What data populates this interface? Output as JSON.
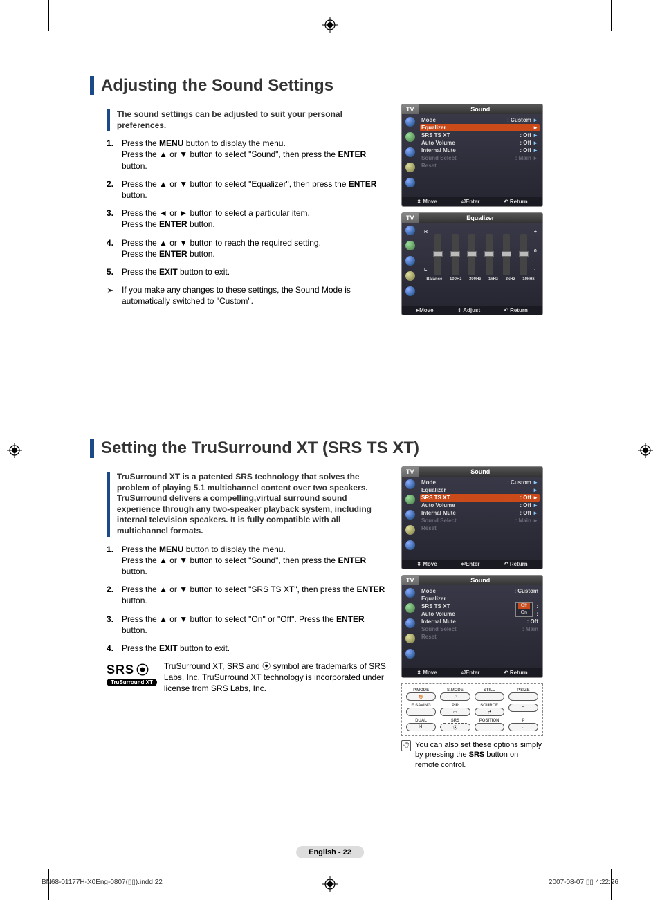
{
  "section1": {
    "title": "Adjusting the Sound Settings",
    "intro": "The sound settings can be adjusted to suit your personal preferences.",
    "steps": [
      {
        "num": "1.",
        "html": "Press the <b>MENU</b> button to display the menu.<br>Press the ▲ or ▼ button to select \"Sound\", then press the <b>ENTER</b> button."
      },
      {
        "num": "2.",
        "html": "Press the ▲ or ▼ button to select \"Equalizer\", then press the <b>ENTER</b> button."
      },
      {
        "num": "3.",
        "html": "Press the ◄ or ► button to select a particular item.<br>Press the <b>ENTER</b> button."
      },
      {
        "num": "4.",
        "html": "Press the ▲ or ▼ button to reach the required setting.<br>Press the <b>ENTER</b> button."
      },
      {
        "num": "5.",
        "html": "Press the <b>EXIT</b> button to exit."
      }
    ],
    "note": "If you make any changes to these settings, the Sound Mode is automatically switched to \"Custom\".",
    "osd1": {
      "tv": "TV",
      "title": "Sound",
      "rows": [
        {
          "lbl": "Mode",
          "val": ": Custom",
          "tri": "►"
        },
        {
          "lbl": "Equalizer",
          "val": "",
          "tri": "►",
          "hi": true
        },
        {
          "lbl": "SRS TS XT",
          "val": ": Off",
          "tri": "►"
        },
        {
          "lbl": "Auto Volume",
          "val": ": Off",
          "tri": "►"
        },
        {
          "lbl": "Internal Mute",
          "val": ": Off",
          "tri": "►"
        },
        {
          "lbl": "Sound Select",
          "val": ": Main",
          "tri": "►",
          "dim": true
        },
        {
          "lbl": "Reset",
          "val": "",
          "tri": "",
          "dim": true
        }
      ],
      "foot": [
        "⇕ Move",
        "⏎Enter",
        "↶ Return"
      ]
    },
    "osd2": {
      "tv": "TV",
      "title": "Equalizer",
      "left": [
        "R",
        "",
        "",
        "L"
      ],
      "right": [
        "+",
        "",
        "0",
        "",
        "-"
      ],
      "bands": [
        "Balance",
        "100Hz",
        "300Hz",
        "1kHz",
        "3kHz",
        "10kHz"
      ],
      "foot": [
        "▸Move",
        "⇕ Adjust",
        "↶ Return"
      ]
    }
  },
  "section2": {
    "title": "Setting the TruSurround XT (SRS TS XT)",
    "intro": "TruSurround XT is a patented SRS technology that solves the problem of playing 5.1 multichannel content over two speakers. TruSurround delivers a compelling,virtual surround sound experience through any two-speaker playback system, including internal television speakers. It is fully compatible with all multichannel formats.",
    "steps": [
      {
        "num": "1.",
        "html": "Press the <b>MENU</b> button to display the menu.<br>Press the ▲ or ▼ button to select \"Sound\", then press the <b>ENTER</b> button."
      },
      {
        "num": "2.",
        "html": "Press the ▲ or ▼ button to select \"SRS TS XT\", then press the <b>ENTER</b> button."
      },
      {
        "num": "3.",
        "html": "Press the ▲ or ▼ button to select \"On\" or \"Off\". Press the <b>ENTER</b> button."
      },
      {
        "num": "4.",
        "html": "Press the <b>EXIT</b> button to exit."
      }
    ],
    "srs_logo_top": "SRS",
    "srs_logo_pill": "TruSurround XT",
    "srs_text": "TruSurround XT, SRS and ⦿ symbol are trademarks of SRS Labs, Inc. TruSurround XT technology is incorporated under license from SRS Labs, Inc.",
    "osd1": {
      "tv": "TV",
      "title": "Sound",
      "rows": [
        {
          "lbl": "Mode",
          "val": ": Custom",
          "tri": "►"
        },
        {
          "lbl": "Equalizer",
          "val": "",
          "tri": "►"
        },
        {
          "lbl": "SRS TS XT",
          "val": ": Off",
          "tri": "►",
          "hi": true
        },
        {
          "lbl": "Auto Volume",
          "val": ": Off",
          "tri": "►"
        },
        {
          "lbl": "Internal Mute",
          "val": ": Off",
          "tri": "►"
        },
        {
          "lbl": "Sound Select",
          "val": ": Main",
          "tri": "►",
          "dim": true
        },
        {
          "lbl": "Reset",
          "val": "",
          "tri": "",
          "dim": true
        }
      ],
      "foot": [
        "⇕ Move",
        "⏎Enter",
        "↶ Return"
      ]
    },
    "osd2": {
      "tv": "TV",
      "title": "Sound",
      "rows": [
        {
          "lbl": "Mode",
          "val": ": Custom",
          "tri": ""
        },
        {
          "lbl": "Equalizer",
          "val": "",
          "tri": ""
        },
        {
          "lbl": "SRS TS XT",
          "val": ":",
          "tri": "",
          "hi_val_only": true,
          "popup": [
            "Off",
            "On"
          ]
        },
        {
          "lbl": "Auto Volume",
          "val": ":",
          "tri": ""
        },
        {
          "lbl": "Internal Mute",
          "val": ": Off",
          "tri": ""
        },
        {
          "lbl": "Sound Select",
          "val": ": Main",
          "tri": "",
          "dim": true
        },
        {
          "lbl": "Reset",
          "val": "",
          "tri": "",
          "dim": true
        }
      ],
      "foot": [
        "⇕ Move",
        "⏎Enter",
        "↶ Return"
      ]
    },
    "remote": {
      "rows": [
        [
          {
            "lbl": "P.MODE",
            "btn": "🎨"
          },
          {
            "lbl": "S.MODE",
            "btn": "♫"
          },
          {
            "lbl": "STILL",
            "btn": ""
          },
          {
            "lbl": "P.SIZE",
            "btn": ""
          }
        ],
        [
          {
            "lbl": "E.SAVING",
            "btn": ""
          },
          {
            "lbl": "PIP",
            "btn": "▭"
          },
          {
            "lbl": "SOURCE",
            "btn": "⇄"
          },
          {
            "lbl": "",
            "btn": "⌃"
          }
        ],
        [
          {
            "lbl": "DUAL",
            "btn": "I-II"
          },
          {
            "lbl": "SRS",
            "btn": "⦿",
            "hi": true
          },
          {
            "lbl": "POSITION",
            "btn": ""
          },
          {
            "lbl": "P",
            "btn": "⌄"
          }
        ]
      ]
    },
    "tip": "You can also set these options simply by pressing the <b>SRS</b> button on remote control."
  },
  "footer": {
    "pagenum": "English - 22",
    "left": "BN68-01177H-X0Eng-0807(▯▯).indd   22",
    "right": "2007-08-07   ▯▯ 4:22:26"
  }
}
